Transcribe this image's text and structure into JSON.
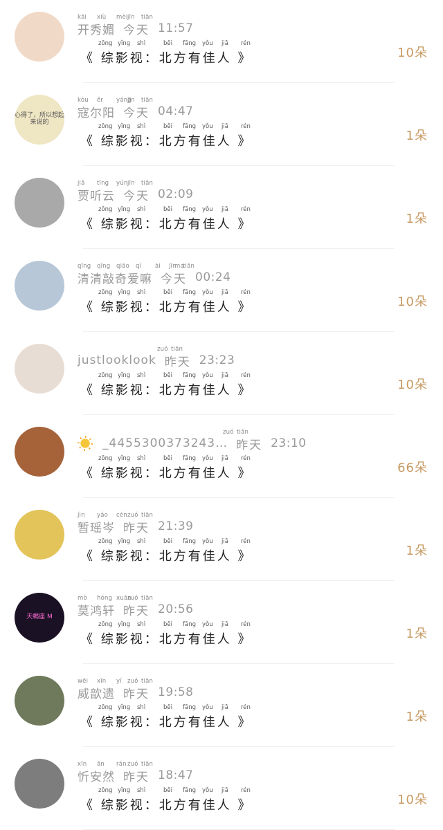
{
  "message": {
    "pinyin": [
      "zōng",
      "yǐng",
      "shì",
      "běi",
      "fāng",
      "yǒu",
      "jiā",
      "rén"
    ],
    "text": "《 综影视：北方有佳人 》"
  },
  "items": [
    {
      "name_pinyin": [
        "kāi",
        "xiù",
        "mèi"
      ],
      "name": "开秀媚",
      "day_pinyin": [
        "jīn",
        "tiān"
      ],
      "day": "今天",
      "time": "11:57",
      "gift": "10朵",
      "avatar_color": "#f1d9c8"
    },
    {
      "name_pinyin": [
        "kòu",
        "ěr",
        "yáng"
      ],
      "name": "寇尔阳",
      "day_pinyin": [
        "jīn",
        "tiān"
      ],
      "day": "今天",
      "time": "04:47",
      "gift": "1朵",
      "avatar_color": "#efe6c4",
      "avatar_text": "心得了，所以想起来说的"
    },
    {
      "name_pinyin": [
        "jiǎ",
        "tīng",
        "yún"
      ],
      "name": "贾听云",
      "day_pinyin": [
        "jīn",
        "tiān"
      ],
      "day": "今天",
      "time": "02:09",
      "gift": "1朵",
      "avatar_color": "#a9a9a9"
    },
    {
      "name_pinyin": [
        "qīng",
        "qīng",
        "qiāo",
        "qí",
        "ài",
        "ma"
      ],
      "name": "清清敲奇爱嘛",
      "day_pinyin": [
        "jīn",
        "tiān"
      ],
      "day": "今天",
      "time": "00:24",
      "gift": "10朵",
      "avatar_color": "#b7c7d8"
    },
    {
      "name_pinyin": [],
      "name": "justlooklook",
      "day_pinyin": [
        "zuó",
        "tiān"
      ],
      "day": "昨天",
      "time": "23:23",
      "gift": "10朵",
      "avatar_color": "#e8ddd5"
    },
    {
      "name_pinyin": [],
      "name": "_4455300373243…",
      "has_sun": true,
      "day_pinyin": [
        "zuó",
        "tiān"
      ],
      "day": "昨天",
      "time": "23:10",
      "gift": "66朵",
      "avatar_color": "#a6633a"
    },
    {
      "name_pinyin": [
        "jìn",
        "yáo",
        "cén"
      ],
      "name": "暂瑶岑",
      "day_pinyin": [
        "zuó",
        "tiān"
      ],
      "day": "昨天",
      "time": "21:39",
      "gift": "1朵",
      "avatar_color": "#e3c45a"
    },
    {
      "name_pinyin": [
        "mò",
        "hóng",
        "xuān"
      ],
      "name": "莫鸿轩",
      "day_pinyin": [
        "zuó",
        "tiān"
      ],
      "day": "昨天",
      "time": "20:56",
      "gift": "1朵",
      "avatar_color": "#1b1124",
      "avatar_text": "天蝎座 M"
    },
    {
      "name_pinyin": [
        "wēi",
        "xīn",
        "yí"
      ],
      "name": "威歆遗",
      "day_pinyin": [
        "zuó",
        "tiān"
      ],
      "day": "昨天",
      "time": "19:58",
      "gift": "1朵",
      "avatar_color": "#6f7a5c"
    },
    {
      "name_pinyin": [
        "xīn",
        "ān",
        "rán"
      ],
      "name": "忻安然",
      "day_pinyin": [
        "zuó",
        "tiān"
      ],
      "day": "昨天",
      "time": "18:47",
      "gift": "10朵",
      "avatar_color": "#7d7d7d"
    }
  ]
}
